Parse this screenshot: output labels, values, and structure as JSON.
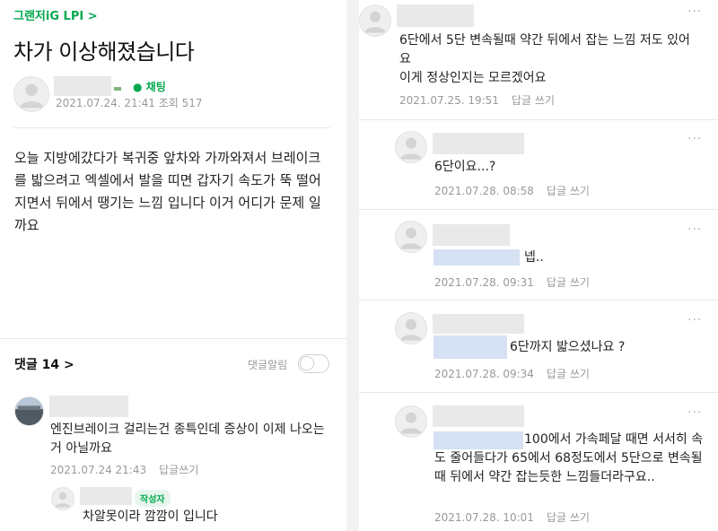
{
  "post": {
    "cafe": "그랜저iG LPI >",
    "title": "차가 이상해졌습니다",
    "chat_label": "채팅",
    "meta": "2021.07.24. 21:41  조회 517",
    "body": "오늘 지방에갔다가 복귀중 앞차와 가까와져서 브레이크를 밟으려고 엑셀에서 발을 띠면  갑자기 속도가 뚝 떨어지면서 뒤에서 땡기는 느낌 입니다 이거 어디가 문제 일까요",
    "comments_label": "댓글 14 >",
    "notify_label": "댓글알림"
  },
  "left_comments": [
    {
      "text": "엔진브레이크 걸리는건 종특인데 증상이 이제 나오는거 아닐까요",
      "date": "2021.07.24 21:43",
      "reply": "답글쓰기"
    },
    {
      "badge": "작성자",
      "text": "차알못이라 깜깜이 입니다"
    }
  ],
  "right_comments": [
    {
      "text": "6단에서 5단 변속될때 약간 뒤에서 잡는 느낌 저도 있어요\n이게 정상인지는 모르겠어요",
      "date": "2021.07.25. 19:51",
      "reply": "답글 쓰기",
      "more": "···"
    },
    {
      "text": "6단이요...?",
      "date": "2021.07.28. 08:58",
      "reply": "답글 쓰기",
      "more": "···"
    },
    {
      "text": "넵..",
      "date": "2021.07.28. 09:31",
      "reply": "답글 쓰기",
      "more": "···"
    },
    {
      "text": "6단까지 밟으셨나요 ?",
      "date": "2021.07.28. 09:34",
      "reply": "답글 쓰기",
      "more": "···"
    },
    {
      "text": "100에서 가속페달 때면 서서히 속도 줄어들다가 65에서 68정도에서 5단으로 변속될때 뒤에서 약간 잡는듯한 느낌들더라구요..",
      "date": "2021.07.28. 10:01",
      "reply": "답글 쓰기",
      "more": "···"
    }
  ]
}
